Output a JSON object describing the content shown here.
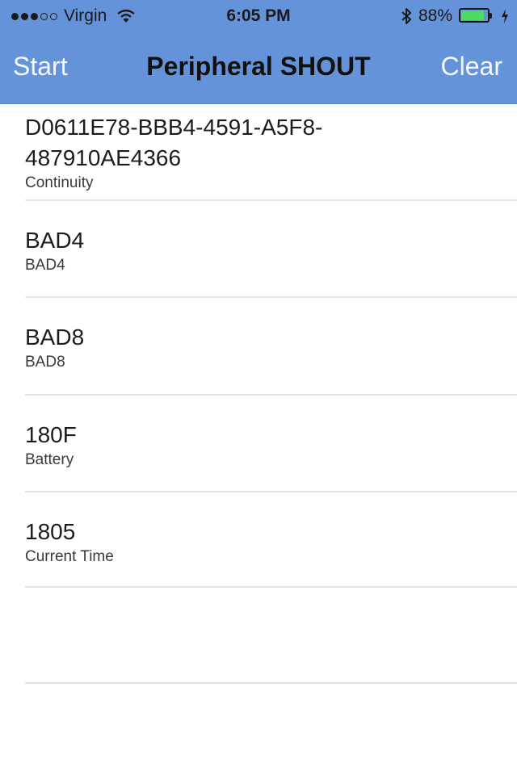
{
  "status_bar": {
    "carrier": "Virgin",
    "time": "6:05 PM",
    "battery_percent": "88%",
    "battery_level": 0.88,
    "signal_bars_filled": 3,
    "signal_bars_total": 5,
    "icons": [
      "wifi-icon",
      "bluetooth-icon",
      "battery-icon",
      "charging-icon"
    ]
  },
  "nav": {
    "left_button": "Start",
    "title": "Peripheral SHOUT",
    "right_button": "Clear"
  },
  "services": [
    {
      "uuid": "D0611E78-BBB4-4591-A5F8-487910AE4366",
      "name": "Continuity"
    },
    {
      "uuid": "BAD4",
      "name": "BAD4"
    },
    {
      "uuid": "BAD8",
      "name": "BAD8"
    },
    {
      "uuid": "180F",
      "name": "Battery"
    },
    {
      "uuid": "1805",
      "name": "Current Time"
    }
  ],
  "colors": {
    "nav_background": "#6593d9",
    "nav_button_text": "#f4f8ff",
    "title_text": "#111111",
    "separator": "#e3e3e6",
    "battery_fill": "#4cd964"
  }
}
